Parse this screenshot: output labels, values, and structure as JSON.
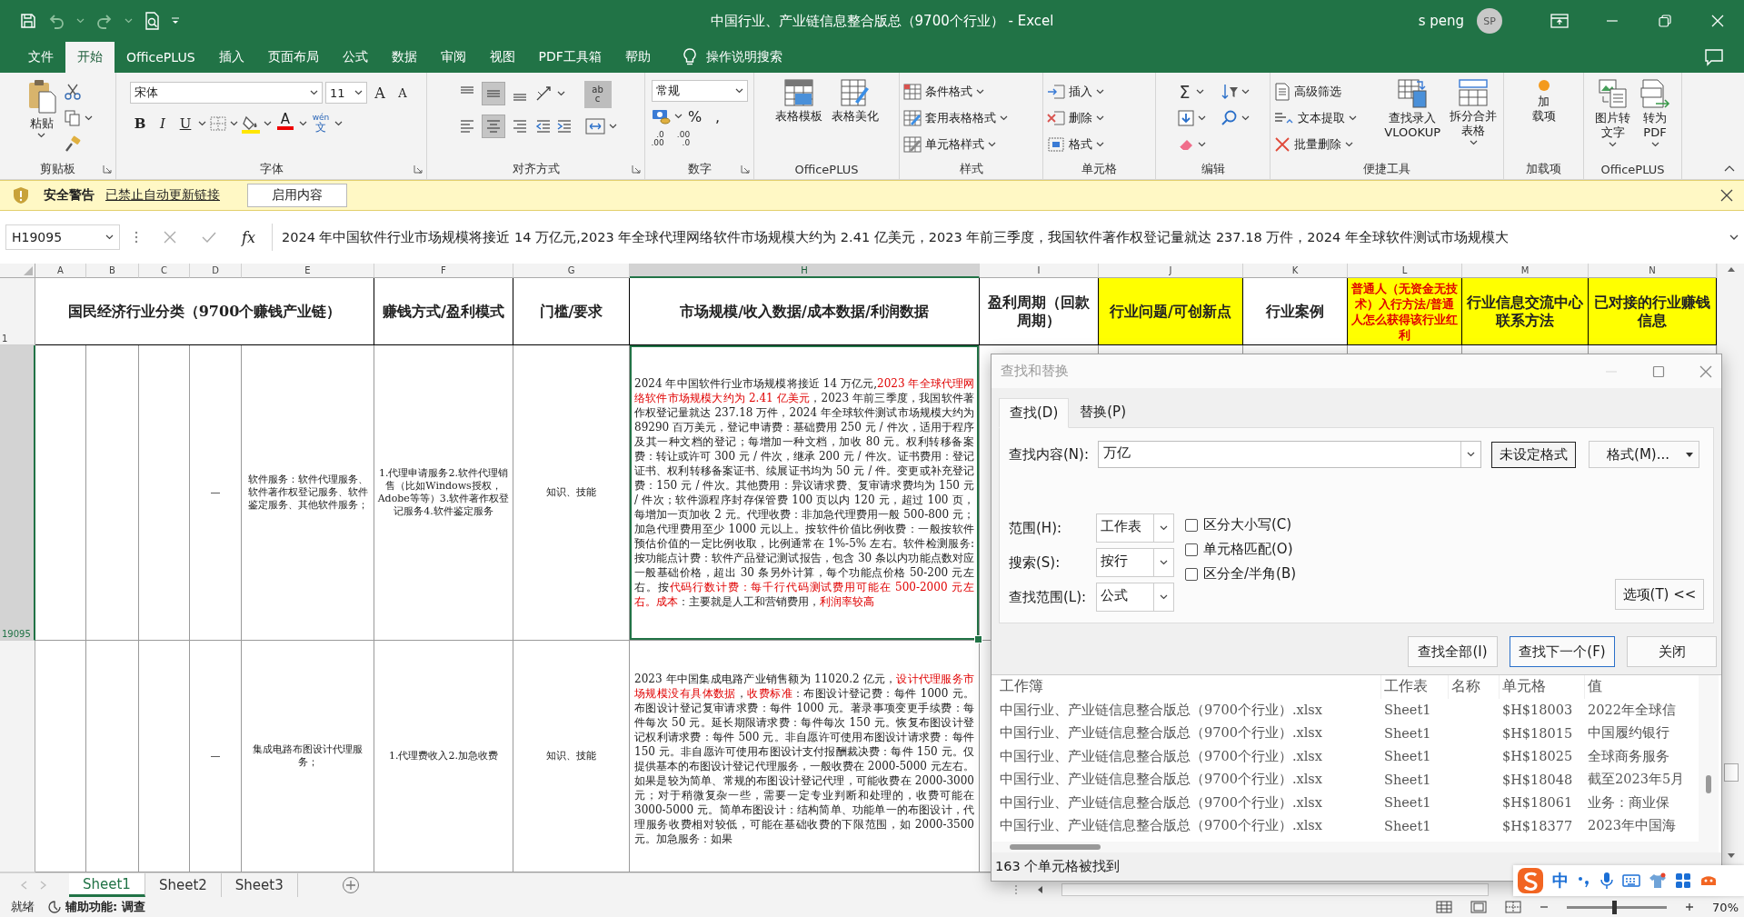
{
  "window": {
    "title": "中国行业、产业链信息整合版总（9700个行业） - Excel",
    "user": "s peng",
    "avatar": "SP"
  },
  "menu_tabs": [
    {
      "label": "文件",
      "selected": false
    },
    {
      "label": "开始",
      "selected": true
    },
    {
      "label": "OfficePLUS",
      "selected": false
    },
    {
      "label": "插入",
      "selected": false
    },
    {
      "label": "页面布局",
      "selected": false
    },
    {
      "label": "公式",
      "selected": false
    },
    {
      "label": "数据",
      "selected": false
    },
    {
      "label": "审阅",
      "selected": false
    },
    {
      "label": "视图",
      "selected": false
    },
    {
      "label": "PDF工具箱",
      "selected": false
    },
    {
      "label": "帮助",
      "selected": false
    }
  ],
  "tell_me": "操作说明搜索",
  "ribbon": {
    "groups": [
      {
        "kind": "clipboard",
        "label": "剪贴板",
        "buttons": [
          {
            "label": "粘贴",
            "dropdown": true
          }
        ]
      },
      {
        "kind": "font",
        "label": "字体",
        "font": "宋体",
        "size": "11",
        "grow": "A",
        "shrink": "A",
        "styles": [
          "B",
          "I",
          "U"
        ],
        "font_color": "A",
        "phonetic": "wén",
        "phonetic_char": "文"
      },
      {
        "kind": "alignment",
        "label": "对齐方式",
        "vertical": [
          {
            "selected": false
          },
          {
            "selected": true
          },
          {
            "selected": false
          }
        ],
        "horizontal": [
          {
            "selected": false
          },
          {
            "selected": true
          },
          {
            "selected": false
          }
        ],
        "wrap": [
          "ab",
          "c"
        ]
      },
      {
        "kind": "number",
        "label": "数字",
        "format": "常规",
        "symbols": [
          "%",
          ","
        ],
        "decimals": [
          [
            ".0",
            ".00"
          ],
          [
            ".00",
            ".0"
          ]
        ]
      },
      {
        "kind": "large",
        "label": "OfficePLUS",
        "buttons": [
          {
            "label": [
              "表格模板"
            ],
            "dropdown": false
          },
          {
            "label": [
              "表格美化"
            ],
            "dropdown": false
          }
        ]
      },
      {
        "kind": "list",
        "label": "样式",
        "buttons": [
          {
            "label": "条件格式",
            "dropdown": true
          },
          {
            "label": "套用表格格式",
            "dropdown": true
          },
          {
            "label": "单元格样式",
            "dropdown": true
          }
        ]
      },
      {
        "kind": "list",
        "label": "单元格",
        "buttons": [
          {
            "label": "插入",
            "dropdown": true
          },
          {
            "label": "删除",
            "dropdown": true
          },
          {
            "label": "格式",
            "dropdown": true
          }
        ]
      },
      {
        "kind": "editing",
        "label": "编辑",
        "sum": "Σ"
      },
      {
        "kind": "tools",
        "label": "便捷工具",
        "buttons": [
          {
            "label": "高级筛选",
            "dropdown": false
          },
          {
            "label": "文本提取",
            "dropdown": true
          },
          {
            "label": "批量删除",
            "dropdown": true
          }
        ],
        "large": [
          {
            "label": [
              "查找录入",
              "VLOOKUP"
            ],
            "dropdown": false
          },
          {
            "label": [
              "拆分合并",
              "表格"
            ],
            "dropdown": true
          }
        ]
      },
      {
        "kind": "large",
        "label": "加载项",
        "buttons": [
          {
            "label": [
              "加",
              "载项"
            ],
            "dropdown": false
          }
        ]
      },
      {
        "kind": "large",
        "label": "OfficePLUS",
        "buttons": [
          {
            "label": [
              "图片转",
              "文字"
            ],
            "dropdown": true
          },
          {
            "label": [
              "转为",
              "PDF"
            ],
            "dropdown": true
          }
        ]
      }
    ]
  },
  "security_bar": {
    "title": "安全警告",
    "message": "已禁止自动更新链接",
    "button": "启用内容"
  },
  "formula_bar": {
    "name_box": "H19095",
    "function_label": "fx",
    "formula": "2024 年中国软件行业市场规模将接近 14 万亿元,2023 年全球代理网络软件市场规模大约为 2.41 亿美元，2023 年前三季度，我国软件著作权登记量就达 237.18 万件，2024 年全球软件测试市场规模大"
  },
  "columns": [
    {
      "label": "A",
      "selected": false
    },
    {
      "label": "B",
      "selected": false
    },
    {
      "label": "C",
      "selected": false
    },
    {
      "label": "D",
      "selected": false
    },
    {
      "label": "E",
      "selected": false
    },
    {
      "label": "F",
      "selected": false
    },
    {
      "label": "G",
      "selected": false
    },
    {
      "label": "H",
      "selected": true
    },
    {
      "label": "I",
      "selected": false
    },
    {
      "label": "J",
      "selected": false
    },
    {
      "label": "K",
      "selected": false
    },
    {
      "label": "L",
      "selected": false
    },
    {
      "label": "M",
      "selected": false
    },
    {
      "label": "N",
      "selected": false
    }
  ],
  "header_row": {
    "row_number": "1",
    "selected": false,
    "cells": [
      {
        "text": "国民经济行业分类（9700个赚钱产业链）",
        "highlighted": false,
        "alert": false,
        "selected": false
      },
      {
        "text": "赚钱方式/盈利模式",
        "highlighted": false,
        "alert": false,
        "selected": false
      },
      {
        "text": "门槛/要求",
        "highlighted": false,
        "alert": false,
        "selected": false
      },
      {
        "text": "市场规模/收入数据/成本数据/利润数据",
        "highlighted": false,
        "alert": false,
        "selected": false
      },
      {
        "text": "盈利周期（回款周期）",
        "highlighted": false,
        "alert": false,
        "selected": false
      },
      {
        "text": "行业问题/可创新点",
        "highlighted": true,
        "alert": false,
        "selected": false
      },
      {
        "text": "行业案例",
        "highlighted": false,
        "alert": false,
        "selected": false
      },
      {
        "text": "普通人（无资金无技术）入行方法/普通人怎么获得该行业红利",
        "highlighted": true,
        "alert": true,
        "selected": false
      },
      {
        "text": "行业信息交流中心联系方法",
        "highlighted": true,
        "alert": false,
        "selected": false
      },
      {
        "text": "已对接的行业赚钱信息",
        "highlighted": true,
        "alert": false,
        "selected": false
      }
    ]
  },
  "rows": [
    {
      "row_number": "19095",
      "selected": true,
      "cells": [
        {
          "selected": false
        },
        {
          "selected": false
        },
        {
          "selected": false
        },
        {
          "text": "—",
          "selected": false
        },
        {
          "text": "软件服务：软件代理服务、软件著作权登记服务、软件鉴定服务、其他软件服务；",
          "selected": false
        },
        {
          "text": "1.代理申请服务2.软件代理销售（比如Windows授权，Adobe等等）3.软件著作权登记服务4.软件鉴定服务",
          "selected": false
        },
        {
          "text": "知识、技能",
          "selected": false
        },
        {
          "selected": true,
          "runs": [
            {
              "text": "2024 年中国软件行业市场规模将接近 14 万亿元,",
              "emphasis": false
            },
            {
              "text": "2023 年全球代理网络软件市场规模大约为 2.41 亿美元",
              "emphasis": true
            },
            {
              "text": "，2023 年前三季度，我国软件著作权登记量就达 237.18 万件，2024 年全球软件测试市场规模大约为 89290 百万美元，登记申请费：基础费用 250 元 / 件次，适用于程序及其一种文档的登记；每增加一种文档，加收 80 元。权利转移备案费：转让或许可 300 元 / 件次，继承 200 元 / 件次。证书费用：登记证书、权利转移备案证书、续展证书均为 50 元 / 件。变更或补充登记费：150 元 / 件次。其他费用：异议请求费、复审请求费均为 150 元 / 件次；软件源程序封存保管费 100 页以内 120 元，超过 100 页，每增加一页加收 2 元。代理收费：非加急代理费用一般 500-800 元；加急代理费用至少 1000 元以上。按软件价值比例收费：一般按软件预估价值的一定比例收取，比例通常在 1%-5% 左右。软件检测服务:按功能点计费：软件产品登记测试报告，包含 30 条以内功能点数对应一般基础价格，超出 30 条另外计算，每个功能点价格 50-200 元左右。按",
              "emphasis": false
            },
            {
              "text": "代码行数计费：每千行代码测试费用可能在 500-2000 元左右。成本",
              "emphasis": true
            },
            {
              "text": "：主要就是人工和营销费用，",
              "emphasis": false
            },
            {
              "text": "利润率较高",
              "emphasis": true
            }
          ]
        },
        {
          "selected": false
        },
        {
          "selected": false
        },
        {
          "selected": false
        },
        {
          "selected": false
        },
        {
          "selected": false
        },
        {
          "selected": false
        }
      ]
    },
    {
      "selected": false,
      "cells": [
        {
          "selected": false
        },
        {
          "selected": false
        },
        {
          "selected": false
        },
        {
          "text": "—",
          "selected": false
        },
        {
          "text": "集成电路布图设计代理服务；",
          "selected": false
        },
        {
          "text": "1.代理费收入2.加急收费",
          "selected": false
        },
        {
          "text": "知识、技能",
          "selected": false
        },
        {
          "selected": false,
          "runs": [
            {
              "text": "2023 年中国集成电路产业销售额为 11020.2 亿元，",
              "emphasis": false
            },
            {
              "text": "设计代理服务市场规模没有具体数据",
              "emphasis": true
            },
            {
              "text": "，",
              "emphasis": false
            },
            {
              "text": "收费标准",
              "emphasis": true
            },
            {
              "text": "：布图设计登记费：每件 1000 元。布图设计登记复审请求费：每件 1000 元。著录事项变更手续费：每件每次 50 元。延长期限请求费：每件每次 150 元。恢复布图设计登记权利请求费：每件 500 元。非自愿许可使用布图设计请求费：每件 150 元。非自愿许可使用布图设计支付报酬裁决费：每件 150 元。仅提供基本的布图设计登记代理服务，一般收费在 2000-5000 元左右。如果是较为简单、常规的布图设计登记代理，可能收费在 2000-3000 元；对于稍微复杂一些，需要一定专业判断和处理的，收费可能在 3000-5000 元。简单布图设计：结构简单、功能单一的布图设计，代理服务收费相对较低，可能在基础收费的下限范围，如 2000-3500 元。加急服务：如果",
              "emphasis": false
            }
          ]
        },
        {
          "selected": false
        }
      ]
    }
  ],
  "sheet_tabs": [
    {
      "label": "Sheet1",
      "selected": true
    },
    {
      "label": "Sheet2",
      "selected": false
    },
    {
      "label": "Sheet3",
      "selected": false
    }
  ],
  "status_bar": {
    "ready": "就绪",
    "accessibility": "辅助功能: 调查",
    "zoom": "70%",
    "zoom_slider": {
      "level": 0.45
    }
  },
  "find_dialog": {
    "title": "查找和替换",
    "tabs": [
      {
        "label": "查找(D)",
        "selected": true
      },
      {
        "label": "替换(P)",
        "selected": false
      }
    ],
    "find_label": "查找内容(N):",
    "find_value": "万亿",
    "format_preview": "未设定格式",
    "format_button": "格式(M)...",
    "options": [
      {
        "label": "范围(H):",
        "value": "工作表"
      },
      {
        "label": "搜索(S):",
        "value": "按行"
      },
      {
        "label": "查找范围(L):",
        "value": "公式"
      }
    ],
    "checkboxes": [
      {
        "label": "区分大小写(C)",
        "checked": false
      },
      {
        "label": "单元格匹配(O)",
        "checked": false
      },
      {
        "label": "区分全/半角(B)",
        "checked": false
      }
    ],
    "options_button": "选项(T) <<",
    "buttons": [
      {
        "label": "查找全部(I)",
        "default": false
      },
      {
        "label": "查找下一个(F)",
        "default": true
      },
      {
        "label": "关闭",
        "default": false
      }
    ],
    "results": {
      "columns": [
        "工作簿",
        "工作表",
        "名称",
        "单元格",
        "值"
      ],
      "rows": [
        {
          "workbook": "中国行业、产业链信息整合版总（9700个行业）.xlsx",
          "sheet": "Sheet1",
          "cell": "$H$18003",
          "value": "2022年全球信"
        },
        {
          "workbook": "中国行业、产业链信息整合版总（9700个行业）.xlsx",
          "sheet": "Sheet1",
          "cell": "$H$18015",
          "value": "中国履约银行"
        },
        {
          "workbook": "中国行业、产业链信息整合版总（9700个行业）.xlsx",
          "sheet": "Sheet1",
          "cell": "$H$18025",
          "value": "全球商务服务"
        },
        {
          "workbook": "中国行业、产业链信息整合版总（9700个行业）.xlsx",
          "sheet": "Sheet1",
          "cell": "$H$18048",
          "value": "截至2023年5月"
        },
        {
          "workbook": "中国行业、产业链信息整合版总（9700个行业）.xlsx",
          "sheet": "Sheet1",
          "cell": "$H$18061",
          "value": "业务：商业保"
        },
        {
          "workbook": "中国行业、产业链信息整合版总（9700个行业）.xlsx",
          "sheet": "Sheet1",
          "cell": "$H$18377",
          "value": "2023年中国海"
        }
      ]
    },
    "status": "163 个单元格被找到"
  },
  "ime": {
    "mode": "中"
  }
}
